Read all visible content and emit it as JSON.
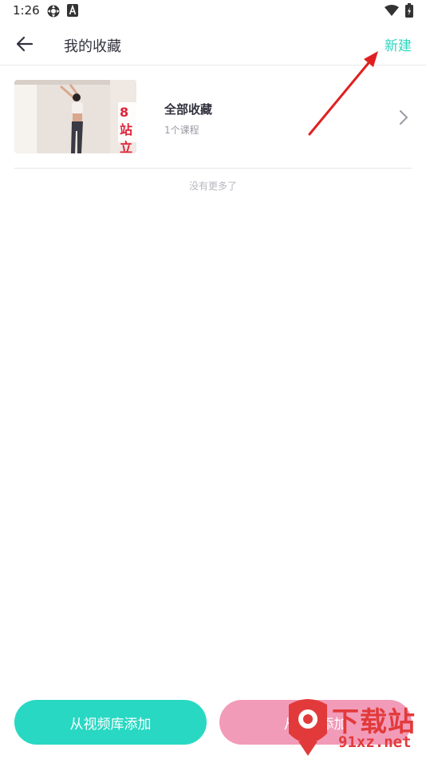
{
  "status_bar": {
    "time": "1:26",
    "left_icons": [
      "settings-gear-icon",
      "app-a-icon"
    ],
    "right_icons": [
      "wifi-icon",
      "battery-icon"
    ]
  },
  "header": {
    "back_icon": "arrow-left-icon",
    "title": "我的收藏",
    "new_label": "新建",
    "accent_color": "#2ed6bf"
  },
  "collections": [
    {
      "title": "全部收藏",
      "count_label": "1个课程",
      "thumbnail_overlay_text": "8站立",
      "chevron_icon": "chevron-right-icon"
    }
  ],
  "list_footer": "没有更多了",
  "buttons": {
    "from_video_library": "从视频库添加",
    "from_website": "从B站添加"
  },
  "colors": {
    "primary": "#28d8c3",
    "secondary": "#f29bb8",
    "annotation": "#e02020"
  },
  "watermark": {
    "text_cn": "下载站",
    "url": "91xz.net"
  }
}
